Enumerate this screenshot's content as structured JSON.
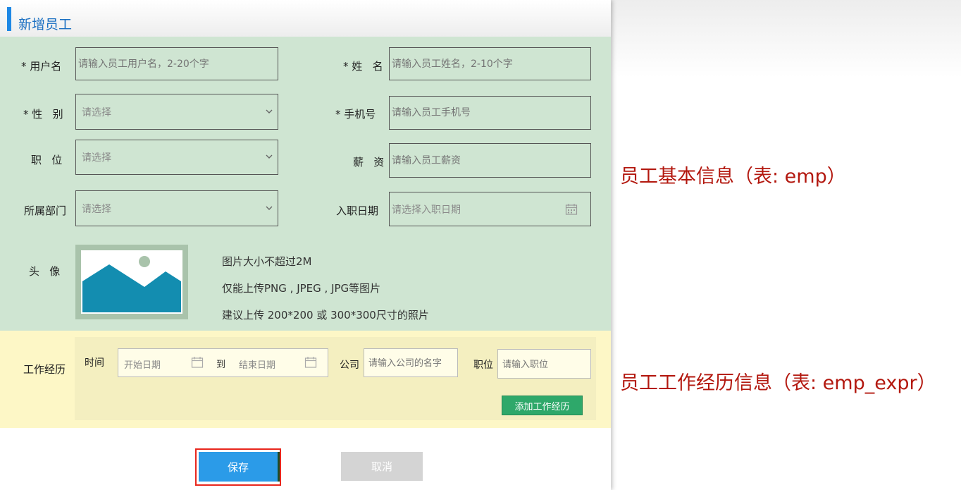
{
  "dialog": {
    "title": "新增员工",
    "accent_color": "#1e88e5"
  },
  "basic": {
    "username": {
      "label": "* 用户名",
      "placeholder": "请输入员工用户名，2-20个字"
    },
    "name": {
      "label": "* 姓   名",
      "placeholder": "请输入员工姓名，2-10个字"
    },
    "gender": {
      "label": "* 性   别",
      "placeholder": "请选择"
    },
    "phone": {
      "label": "* 手机号",
      "placeholder": "请输入员工手机号"
    },
    "position": {
      "label": "职   位",
      "placeholder": "请选择"
    },
    "salary": {
      "label": "薪   资",
      "placeholder": "请输入员工薪资"
    },
    "department": {
      "label": "所属部门",
      "placeholder": "请选择"
    },
    "hire_date": {
      "label": "入职日期",
      "placeholder": "请选择入职日期"
    },
    "avatar": {
      "label": "头   像",
      "hints": [
        "图片大小不超过2M",
        "仅能上传PNG , JPEG , JPG等图片",
        "建议上传 200*200 或 300*300尺寸的照片"
      ]
    }
  },
  "experience": {
    "label": "工作经历",
    "time_label": "时间",
    "start_placeholder": "开始日期",
    "to_label": "到",
    "end_placeholder": "结束日期",
    "company_label": "公司",
    "company_placeholder": "请输入公司的名字",
    "position_label": "职位",
    "position_placeholder": "请输入职位",
    "add_button": "添加工作经历"
  },
  "actions": {
    "save": "保存",
    "cancel": "取消"
  },
  "annotations": {
    "basic_info": "员工基本信息（表: emp）",
    "work_experience": "员工工作经历信息（表: emp_expr）"
  },
  "colors": {
    "basic_panel": "#cfe5d2",
    "experience_panel": "#fdf7c6",
    "save_button": "#2b9be8",
    "add_button": "#2ea86a",
    "annotation_text": "#b3180f",
    "highlight_border": "#e8271d"
  },
  "icons": {
    "select_arrow": "chevron-down-icon",
    "date_picker": "calendar-icon",
    "avatar_placeholder": "image-placeholder-icon"
  }
}
